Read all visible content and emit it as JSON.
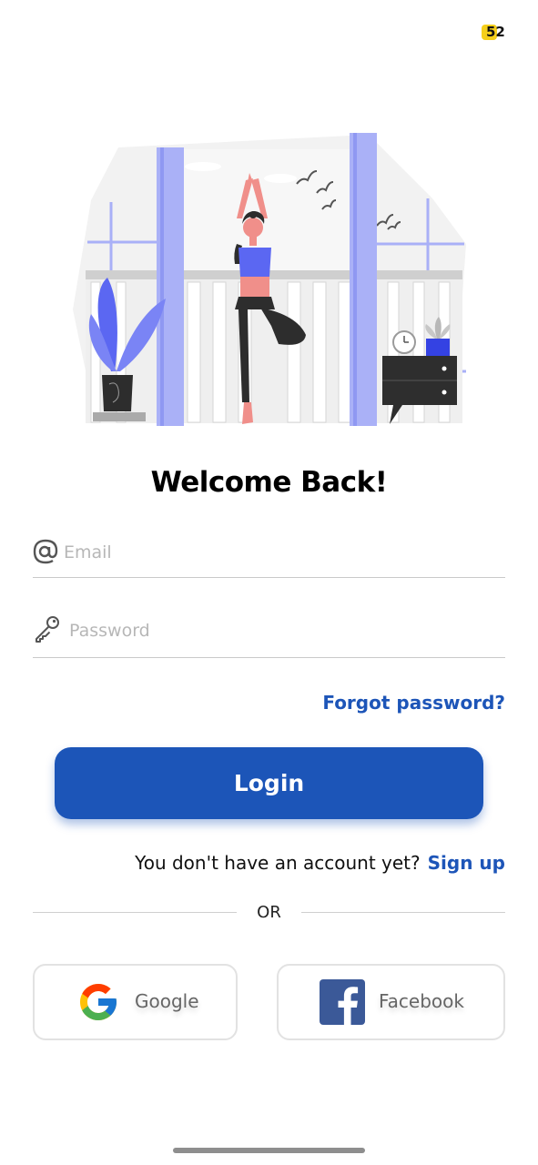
{
  "status": {
    "badge_number": "52"
  },
  "hero": {
    "illustration": "woman-yoga-balcony"
  },
  "title": "Welcome Back!",
  "email": {
    "icon": "at-icon",
    "placeholder": "Email",
    "value": ""
  },
  "password": {
    "icon": "key-icon",
    "placeholder": "Password",
    "value": ""
  },
  "forgot_label": "Forgot password?",
  "login_label": "Login",
  "signup": {
    "prompt": "You don't have an account yet?",
    "link": "Sign up"
  },
  "divider_label": "OR",
  "social": {
    "google": {
      "label": "Google",
      "icon": "google-logo-icon"
    },
    "facebook": {
      "label": "Facebook",
      "icon": "facebook-logo-icon"
    }
  },
  "colors": {
    "primary": "#1c55b8",
    "accent_illustration": "#5b67f2",
    "badge": "#f5cf1b"
  }
}
